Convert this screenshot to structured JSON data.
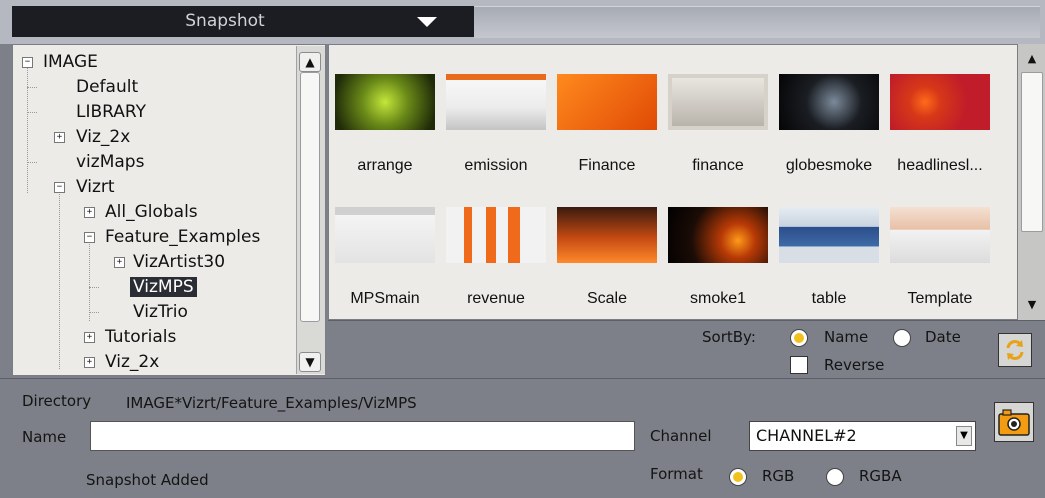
{
  "header": {
    "title": "Snapshot"
  },
  "tree": {
    "items": [
      {
        "label": "IMAGE",
        "expander": "−"
      },
      {
        "label": "Default"
      },
      {
        "label": "LIBRARY"
      },
      {
        "label": "Viz_2x",
        "expander": "+"
      },
      {
        "label": "vizMaps"
      },
      {
        "label": "Vizrt",
        "expander": "−"
      },
      {
        "label": "All_Globals",
        "expander": "+"
      },
      {
        "label": "Feature_Examples",
        "expander": "−"
      },
      {
        "label": "VizArtist30",
        "expander": "+"
      },
      {
        "label": "VizMPS",
        "selected": true
      },
      {
        "label": "VizTrio"
      },
      {
        "label": "Tutorials",
        "expander": "+"
      },
      {
        "label": "Viz_2x",
        "expander": "+"
      }
    ]
  },
  "thumbnails": [
    {
      "label": "arrange"
    },
    {
      "label": "emission"
    },
    {
      "label": "Finance"
    },
    {
      "label": "finance"
    },
    {
      "label": "globesmoke"
    },
    {
      "label": "headlinesl..."
    },
    {
      "label": "MPSmain"
    },
    {
      "label": "revenue"
    },
    {
      "label": "Scale"
    },
    {
      "label": "smoke1"
    },
    {
      "label": "table"
    },
    {
      "label": "Template"
    }
  ],
  "sort": {
    "label": "SortBy:",
    "name_label": "Name",
    "date_label": "Date",
    "reverse_label": "Reverse",
    "selected": "Name",
    "reverse_checked": false
  },
  "directory": {
    "label": "Directory",
    "path": "IMAGE*Vizrt/Feature_Examples/VizMPS"
  },
  "name": {
    "label": "Name",
    "value": ""
  },
  "channel": {
    "label": "Channel",
    "value": "CHANNEL#2"
  },
  "format": {
    "label": "Format",
    "rgb_label": "RGB",
    "rgba_label": "RGBA",
    "selected": "RGB"
  },
  "status": "Snapshot Added",
  "icons": {
    "refresh": "refresh-icon",
    "camera": "camera-icon",
    "dropdown": "chevron-down-icon"
  },
  "colors": {
    "accent": "#f3c11e",
    "selection": "#2a2d33"
  }
}
